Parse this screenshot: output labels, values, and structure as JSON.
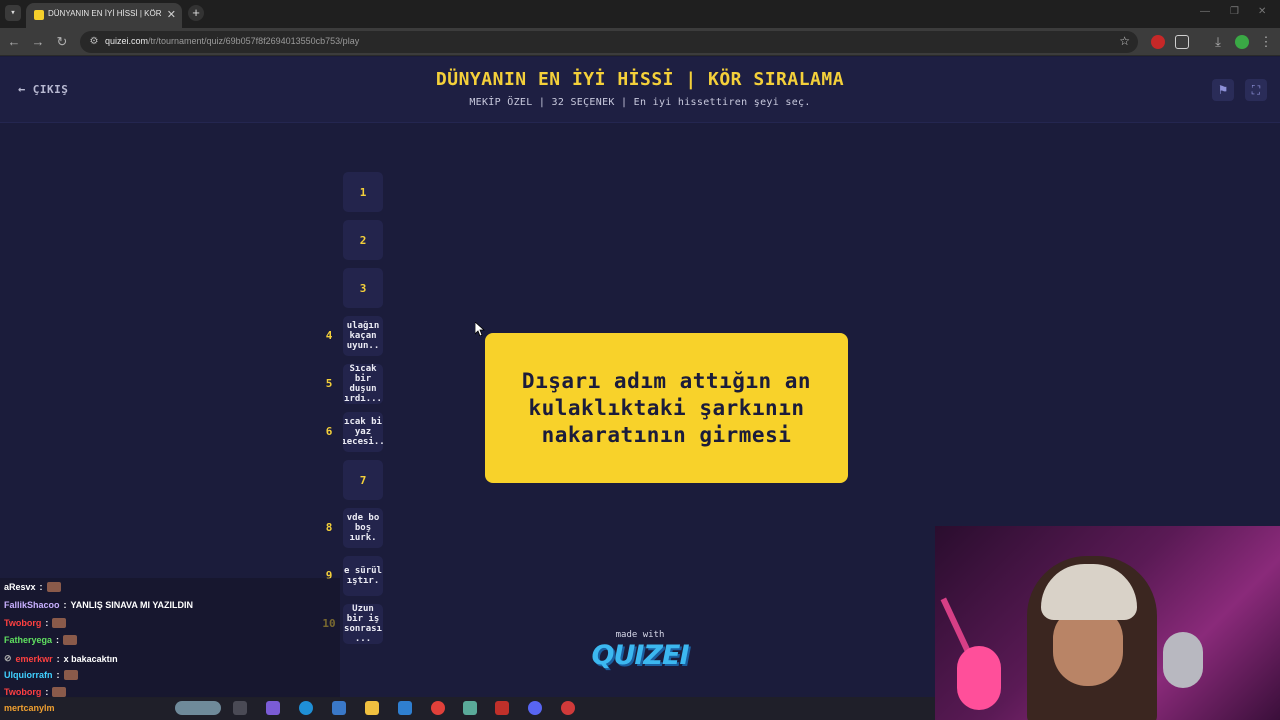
{
  "browser": {
    "tab_title": "DÜNYANIN EN İYİ HİSSİ | KÖR S",
    "tab_close": "✕",
    "new_tab": "+",
    "url_host": "quizei.com",
    "url_path": "/tr/tournament/quiz/69b057f8f2694013550cb753/play"
  },
  "header": {
    "exit_label": "ÇIKIŞ",
    "title": "DÜNYANIN EN İYİ HİSSİ | KÖR SIRALAMA",
    "subtitle": "MEKİP ÖZEL | 32 SEÇENEK | En iyi hissettiren şeyi seç."
  },
  "slots": [
    {
      "num": "",
      "box": "1"
    },
    {
      "num": "",
      "box": "2"
    },
    {
      "num": "",
      "box": "3"
    },
    {
      "num": "4",
      "box": "ulağın\nkaçan\nuyun.."
    },
    {
      "num": "5",
      "box": "Sıcak\nbir\nduşun\nırdı..."
    },
    {
      "num": "6",
      "box": "ıcak bi\nyaz\nıecesi.."
    },
    {
      "num": "",
      "box": "7"
    },
    {
      "num": "8",
      "box": "vde bo\nboş\nıurk."
    },
    {
      "num": "9",
      "box": "e sürül\nıştır."
    },
    {
      "num": "10",
      "box": "Uzun\nbir iş\nsonrası\n..."
    }
  ],
  "card": {
    "text": "Dışarı adım attığın an kulaklıktaki şarkının nakaratının girmesi"
  },
  "footer": {
    "made_with": "made with",
    "logo": "QUIZEI"
  },
  "chat": [
    {
      "user": "aResvx",
      "msg": "",
      "color": "#ffffff"
    },
    {
      "user": "FallikShacoo",
      "msg": "YANLIŞ SINAVA MI YAZILDIN",
      "color": "#c8b0ff"
    },
    {
      "user": "Twoborg",
      "msg": "",
      "color": "#ff4040"
    },
    {
      "user": "Fatheryega",
      "msg": "",
      "color": "#60e060"
    },
    {
      "user": "emerkwr",
      "msg": "x bakacaktın",
      "color": "#ff4040"
    },
    {
      "user": "Ulquiorrafn",
      "msg": "",
      "color": "#40d0ff"
    },
    {
      "user": "Twoborg",
      "msg": "",
      "color": "#ff4040"
    }
  ],
  "taskbar": {
    "user": "mertcanylm"
  },
  "colors": {
    "accent": "#f4d03a",
    "background": "#1b1c3b",
    "card": "#f8d22a"
  }
}
